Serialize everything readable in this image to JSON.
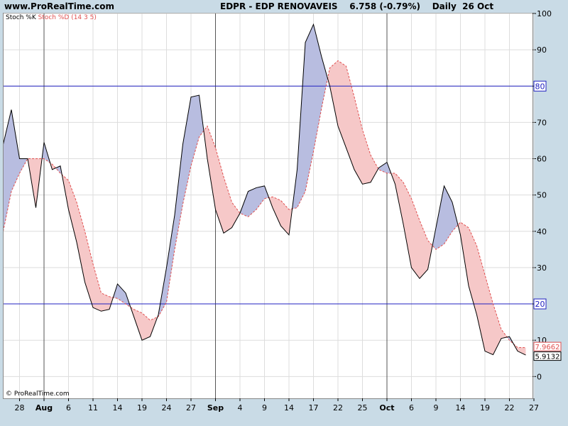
{
  "header": {
    "site": "www.ProRealTime.com",
    "title": "EDPR - EDP RENOVAVEIS    6.758 (-0.79%)    Daily  26 Oct"
  },
  "legend": {
    "k_label": "Stoch %K",
    "d_label": "Stoch %D (14 3 5)"
  },
  "copyright": "© ProRealTime.com",
  "colors": {
    "k_line": "#000000",
    "d_line": "#e05050",
    "k_fill": "#b8bde0",
    "d_fill": "#f6c8c8",
    "level_line": "#2020c0",
    "grid": "#dddddd",
    "background": "#ffffff"
  },
  "chart_data": {
    "type": "line",
    "ylim": [
      -6,
      100
    ],
    "yticks": [
      0,
      10,
      20,
      30,
      40,
      50,
      60,
      70,
      80,
      90,
      100
    ],
    "levels": [
      {
        "value": 80,
        "label": "80"
      },
      {
        "value": 20,
        "label": "20"
      }
    ],
    "last_values": {
      "k": "5.9132",
      "d": "7.9662"
    },
    "x_ticks": [
      {
        "index": 2,
        "label": "28",
        "bold": false
      },
      {
        "index": 5,
        "label": "Aug",
        "bold": true
      },
      {
        "index": 8,
        "label": "6",
        "bold": false
      },
      {
        "index": 11,
        "label": "11",
        "bold": false
      },
      {
        "index": 14,
        "label": "14",
        "bold": false
      },
      {
        "index": 17,
        "label": "19",
        "bold": false
      },
      {
        "index": 20,
        "label": "24",
        "bold": false
      },
      {
        "index": 23,
        "label": "27",
        "bold": false
      },
      {
        "index": 26,
        "label": "Sep",
        "bold": true
      },
      {
        "index": 29,
        "label": "4",
        "bold": false
      },
      {
        "index": 32,
        "label": "9",
        "bold": false
      },
      {
        "index": 35,
        "label": "14",
        "bold": false
      },
      {
        "index": 38,
        "label": "17",
        "bold": false
      },
      {
        "index": 41,
        "label": "22",
        "bold": false
      },
      {
        "index": 44,
        "label": "25",
        "bold": false
      },
      {
        "index": 47,
        "label": "Oct",
        "bold": true
      },
      {
        "index": 50,
        "label": "6",
        "bold": false
      },
      {
        "index": 53,
        "label": "9",
        "bold": false
      },
      {
        "index": 56,
        "label": "14",
        "bold": false
      },
      {
        "index": 59,
        "label": "19",
        "bold": false
      },
      {
        "index": 62,
        "label": "22",
        "bold": false
      },
      {
        "index": 65,
        "label": "27",
        "bold": false
      }
    ],
    "month_starts": [
      5,
      26,
      47
    ],
    "series": [
      {
        "name": "Stoch %K",
        "values": [
          64,
          73.5,
          60,
          60,
          46.5,
          64.5,
          57,
          58,
          46,
          37,
          26,
          19,
          18,
          18.5,
          25.5,
          23,
          16.5,
          10,
          11,
          17,
          30,
          44.5,
          64,
          77,
          77.5,
          60,
          46,
          39.5,
          41,
          45,
          51,
          52,
          52.5,
          46.5,
          41.5,
          39,
          57,
          92,
          97,
          88,
          80,
          69,
          63,
          57,
          53,
          53.5,
          57.5,
          59,
          53,
          42,
          30,
          27,
          29.5,
          41,
          52.5,
          48,
          39,
          25,
          17,
          7,
          6,
          10.5,
          11,
          7,
          5.9132
        ]
      },
      {
        "name": "Stoch %D (14 3 5)",
        "values": [
          40,
          51,
          56,
          60,
          60,
          60,
          58.5,
          56,
          54,
          48,
          40,
          31,
          23,
          22,
          21.5,
          20,
          18.5,
          17.5,
          15.5,
          16.5,
          20.5,
          35,
          47.5,
          58,
          66,
          69,
          63,
          55,
          48,
          45,
          44,
          46,
          49,
          49.5,
          48.5,
          46,
          46.5,
          51,
          62,
          74,
          85,
          87,
          85.5,
          77,
          68,
          61,
          57,
          56,
          56,
          53.5,
          49,
          43,
          37.5,
          35,
          36.5,
          40,
          42.5,
          41,
          36,
          28,
          20,
          13,
          10,
          8,
          7.9662
        ]
      }
    ]
  }
}
